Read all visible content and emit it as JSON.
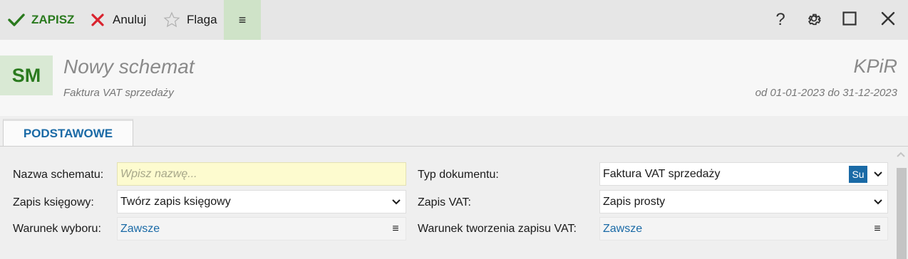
{
  "toolbar": {
    "save_label": "ZAPISZ",
    "cancel_label": "Anuluj",
    "flag_label": "Flaga",
    "menu_label": "≡",
    "help_label": "?"
  },
  "header": {
    "avatar": "SM",
    "title": "Nowy schemat",
    "subtitle": "Faktura VAT sprzedaży",
    "module": "KPiR",
    "period": "od 01-01-2023 do 31-12-2023"
  },
  "tabs": [
    {
      "label": "PODSTAWOWE",
      "active": true
    }
  ],
  "form": {
    "name": {
      "label": "Nazwa schematu:",
      "placeholder": "Wpisz nazwę...",
      "value": ""
    },
    "doc_type": {
      "label": "Typ dokumentu:",
      "value": "Faktura VAT sprzedaży",
      "badge": "Su"
    },
    "entry": {
      "label": "Zapis księgowy:",
      "value": "Twórz zapis księgowy"
    },
    "vat_entry": {
      "label": "Zapis VAT:",
      "value": "Zapis prosty"
    },
    "selection_cond": {
      "label": "Warunek wyboru:",
      "value": "Zawsze",
      "menu": "≡"
    },
    "vat_cond": {
      "label": "Warunek tworzenia zapisu VAT:",
      "value": "Zawsze",
      "menu": "≡"
    }
  },
  "colors": {
    "accent_green": "#2a7a1e",
    "accent_blue": "#1a6aa6",
    "cancel_red": "#d9232e",
    "input_highlight": "#fdfbcf"
  }
}
